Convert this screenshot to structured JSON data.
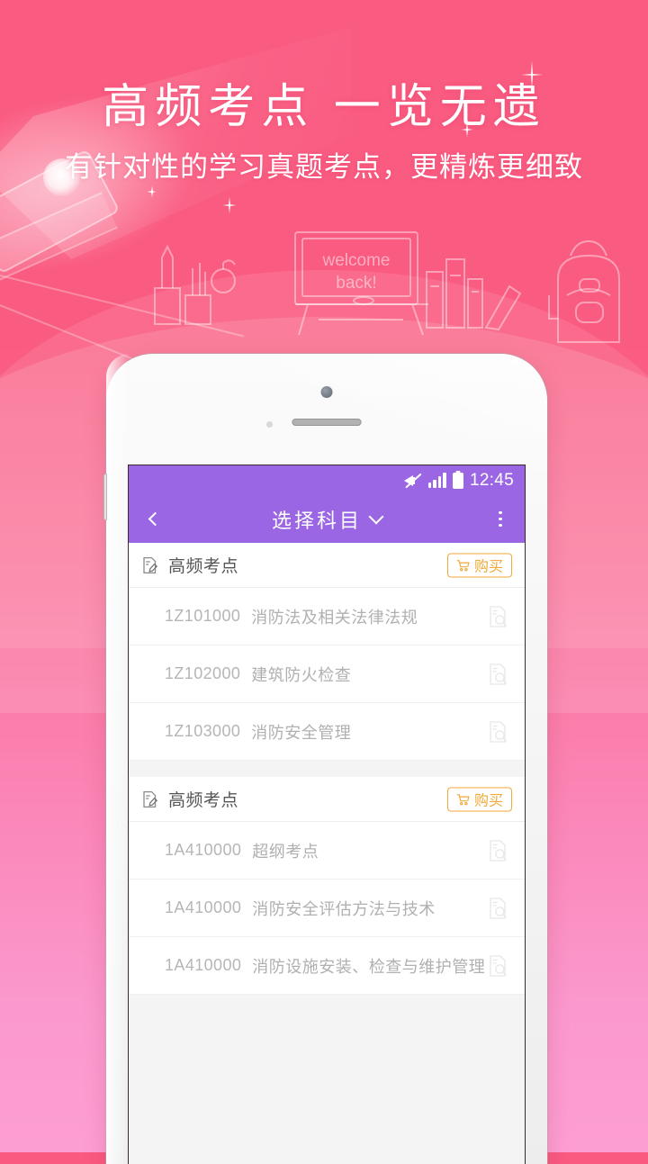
{
  "promo": {
    "title": "高频考点 一览无遗",
    "subtitle": "有针对性的学习真题考点，更精炼更细致",
    "blackboard_line1": "welcome",
    "blackboard_line2": "back!",
    "colors": {
      "pink_top": "#FA5B81",
      "pink_bottom": "#FB99CE"
    }
  },
  "phone": {
    "statusbar": {
      "mute_icon": "mute-icon",
      "signal_icon": "signal-bars-icon",
      "battery_icon": "battery-icon",
      "time": "12:45"
    },
    "navbar": {
      "back_icon": "chevron-left-icon",
      "title": "选择科目",
      "dropdown_icon": "chevron-down-icon",
      "more_icon": "overflow-menu-icon",
      "color": "#9B66E3"
    },
    "sections": [
      {
        "icon": "note-edit-icon",
        "title": "高频考点",
        "buy": {
          "icon": "cart-icon",
          "label": "购买",
          "color": "#F0A93A"
        },
        "rows": [
          {
            "code": "1Z101000",
            "name": "消防法及相关法律法规",
            "icon": "document-search-icon"
          },
          {
            "code": "1Z102000",
            "name": "建筑防火检查",
            "icon": "document-search-icon"
          },
          {
            "code": "1Z103000",
            "name": "消防安全管理",
            "icon": "document-search-icon"
          }
        ]
      },
      {
        "icon": "note-edit-icon",
        "title": "高频考点",
        "buy": {
          "icon": "cart-icon",
          "label": "购买",
          "color": "#F0A93A"
        },
        "rows": [
          {
            "code": "1A410000",
            "name": "超纲考点",
            "icon": "document-search-icon"
          },
          {
            "code": "1A410000",
            "name": "消防安全评估方法与技术",
            "icon": "document-search-icon"
          },
          {
            "code": "1A410000",
            "name": "消防设施安装、检查与维护管理",
            "icon": "document-search-icon"
          }
        ]
      }
    ]
  }
}
